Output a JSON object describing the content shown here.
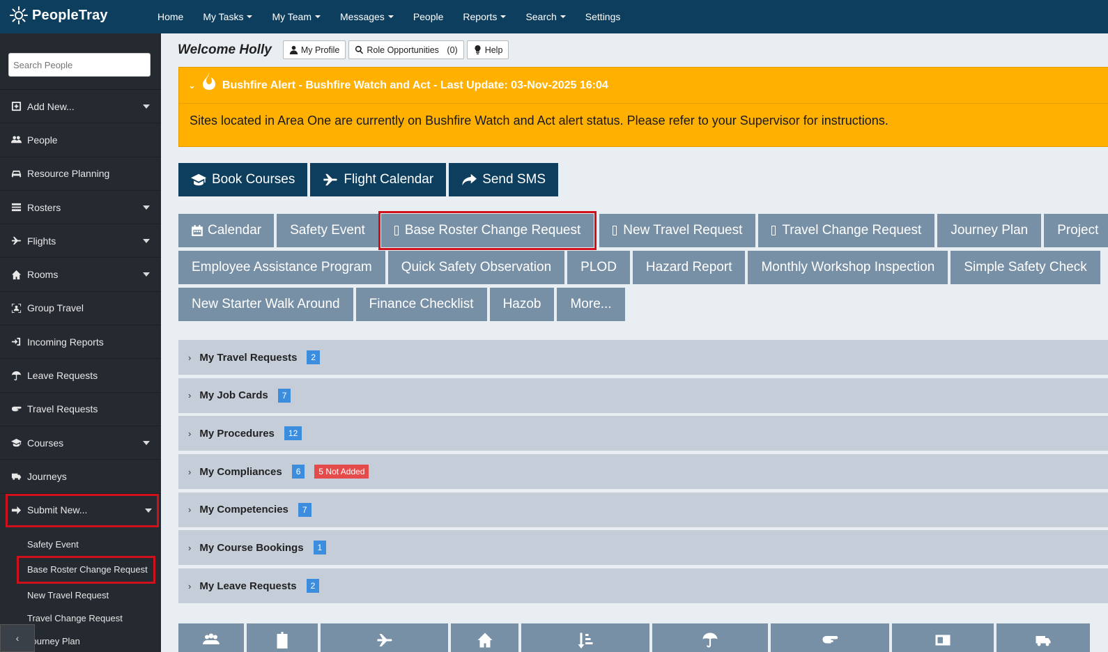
{
  "brand": {
    "name": "PeopleTray"
  },
  "nav": {
    "items": [
      {
        "label": "Home"
      },
      {
        "label": "My Tasks"
      },
      {
        "label": "My Team"
      },
      {
        "label": "Messages"
      },
      {
        "label": "People"
      },
      {
        "label": "Reports"
      },
      {
        "label": "Search"
      },
      {
        "label": "Settings"
      }
    ]
  },
  "sidebar": {
    "search_placeholder": "Search People",
    "items": [
      {
        "label": "Add New...",
        "icon": "plus-square-icon"
      },
      {
        "label": "People",
        "icon": "users-icon"
      },
      {
        "label": "Resource Planning",
        "icon": "car-icon"
      },
      {
        "label": "Rosters",
        "icon": "list-icon"
      },
      {
        "label": "Flights",
        "icon": "plane-icon"
      },
      {
        "label": "Rooms",
        "icon": "home-icon"
      },
      {
        "label": "Group Travel",
        "icon": "group-icon"
      },
      {
        "label": "Incoming Reports",
        "icon": "sign-in-icon"
      },
      {
        "label": "Leave Requests",
        "icon": "umbrella-icon"
      },
      {
        "label": "Travel Requests",
        "icon": "hand-point-icon"
      },
      {
        "label": "Courses",
        "icon": "graduation-cap-icon"
      },
      {
        "label": "Journeys",
        "icon": "truck-icon"
      },
      {
        "label": "Submit New...",
        "icon": "arrow-right-icon"
      }
    ],
    "submenu": [
      {
        "label": "Safety Event"
      },
      {
        "label": "Base Roster Change Request"
      },
      {
        "label": "New Travel Request"
      },
      {
        "label": "Travel Change Request"
      },
      {
        "label": "Journey Plan"
      }
    ],
    "collapse_glyph": "‹"
  },
  "welcome": {
    "text": "Welcome Holly",
    "my_profile": "My Profile",
    "role_opps": "Role Opportunities",
    "role_opps_count": "(0)",
    "help": "Help"
  },
  "alert": {
    "title": "Bushfire Alert - Bushfire Watch and Act - Last Update: 03-Nov-2025 16:04",
    "body": "Sites located in Area One are currently on Bushfire Watch and Act alert status. Please refer to your Supervisor for instructions.",
    "color": "#ffb000"
  },
  "quick_actions": [
    {
      "label": "Book Courses",
      "icon": "graduation-cap-icon"
    },
    {
      "label": "Flight Calendar",
      "icon": "plane-icon"
    },
    {
      "label": "Send SMS",
      "icon": "share-icon"
    }
  ],
  "forms": {
    "row1": [
      {
        "label": "Calendar"
      },
      {
        "label": "Safety Event"
      },
      {
        "label": "Base Roster Change Request"
      },
      {
        "label": "New Travel Request"
      },
      {
        "label": "Travel Change Request"
      },
      {
        "label": "Journey Plan"
      },
      {
        "label": "Project"
      }
    ],
    "row2": [
      {
        "label": "Employee Assistance Program"
      },
      {
        "label": "Quick Safety Observation"
      },
      {
        "label": "PLOD"
      },
      {
        "label": "Hazard Report"
      },
      {
        "label": "Monthly Workshop Inspection"
      },
      {
        "label": "Simple Safety Check"
      }
    ],
    "row3": [
      {
        "label": "New Starter Walk Around"
      },
      {
        "label": "Finance Checklist"
      },
      {
        "label": "Hazob"
      },
      {
        "label": "More..."
      }
    ]
  },
  "panels": [
    {
      "label": "My Travel Requests",
      "count": "2"
    },
    {
      "label": "My Job Cards",
      "count": "7"
    },
    {
      "label": "My Procedures",
      "count": "12"
    },
    {
      "label": "My Compliances",
      "count": "6",
      "extra": "5 Not Added"
    },
    {
      "label": "My Competencies",
      "count": "7"
    },
    {
      "label": "My Course Bookings",
      "count": "1"
    },
    {
      "label": "My Leave Requests",
      "count": "2"
    }
  ],
  "tiles": [
    {
      "icon": "users-icon"
    },
    {
      "icon": "id-badge-icon"
    },
    {
      "icon": "plane-icon"
    },
    {
      "icon": "home-icon"
    },
    {
      "icon": "sort-icon"
    },
    {
      "icon": "umbrella-icon"
    },
    {
      "icon": "hand-point-icon"
    },
    {
      "icon": "id-card-icon"
    },
    {
      "icon": "truck-icon"
    }
  ],
  "colors": {
    "nav": "#0e3e5e",
    "sidebar": "#252a30",
    "form_button": "#7890a6",
    "panel": "#c5ced8",
    "badge": "#3c8dde",
    "badge_red": "#e64b4b",
    "highlight": "#d0101a"
  }
}
